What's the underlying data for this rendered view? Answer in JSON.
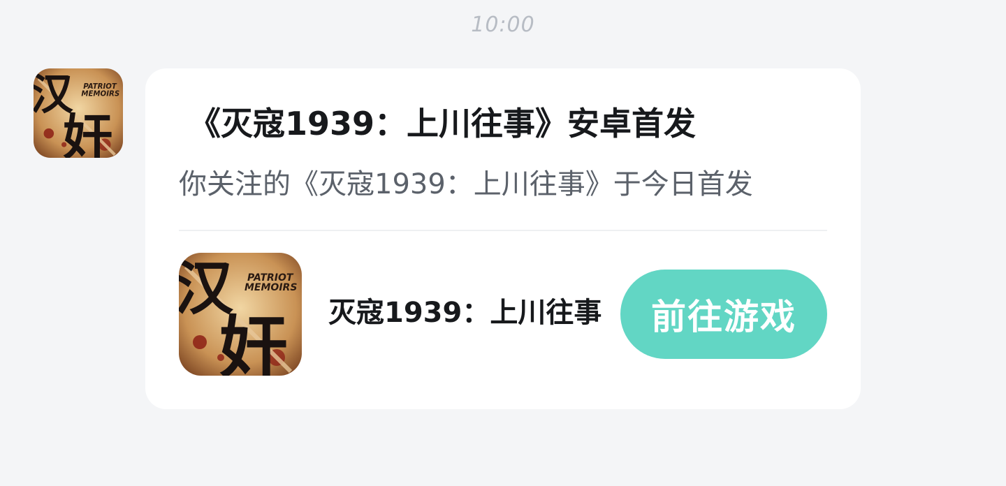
{
  "timestamp": "10:00",
  "message": {
    "title": "《灭寇1939：上川往事》安卓首发",
    "description": "你关注的《灭寇1939：上川往事》于今日首发",
    "game": {
      "name": "灭寇1939：上川往事",
      "icon_text_line1": "PATRIOT",
      "icon_text_line2": "MEMOIRS",
      "icon_glyph1": "汉",
      "icon_glyph2": "奸"
    },
    "action_label": "前往游戏"
  },
  "colors": {
    "background": "#f4f5f7",
    "card": "#ffffff",
    "accent": "#62d6c4",
    "title_text": "#17191c",
    "secondary_text": "#5b616a",
    "timestamp": "#b7bcc4"
  },
  "icons": {
    "sender_avatar": "game-logo-icon",
    "game_icon": "game-logo-icon"
  }
}
